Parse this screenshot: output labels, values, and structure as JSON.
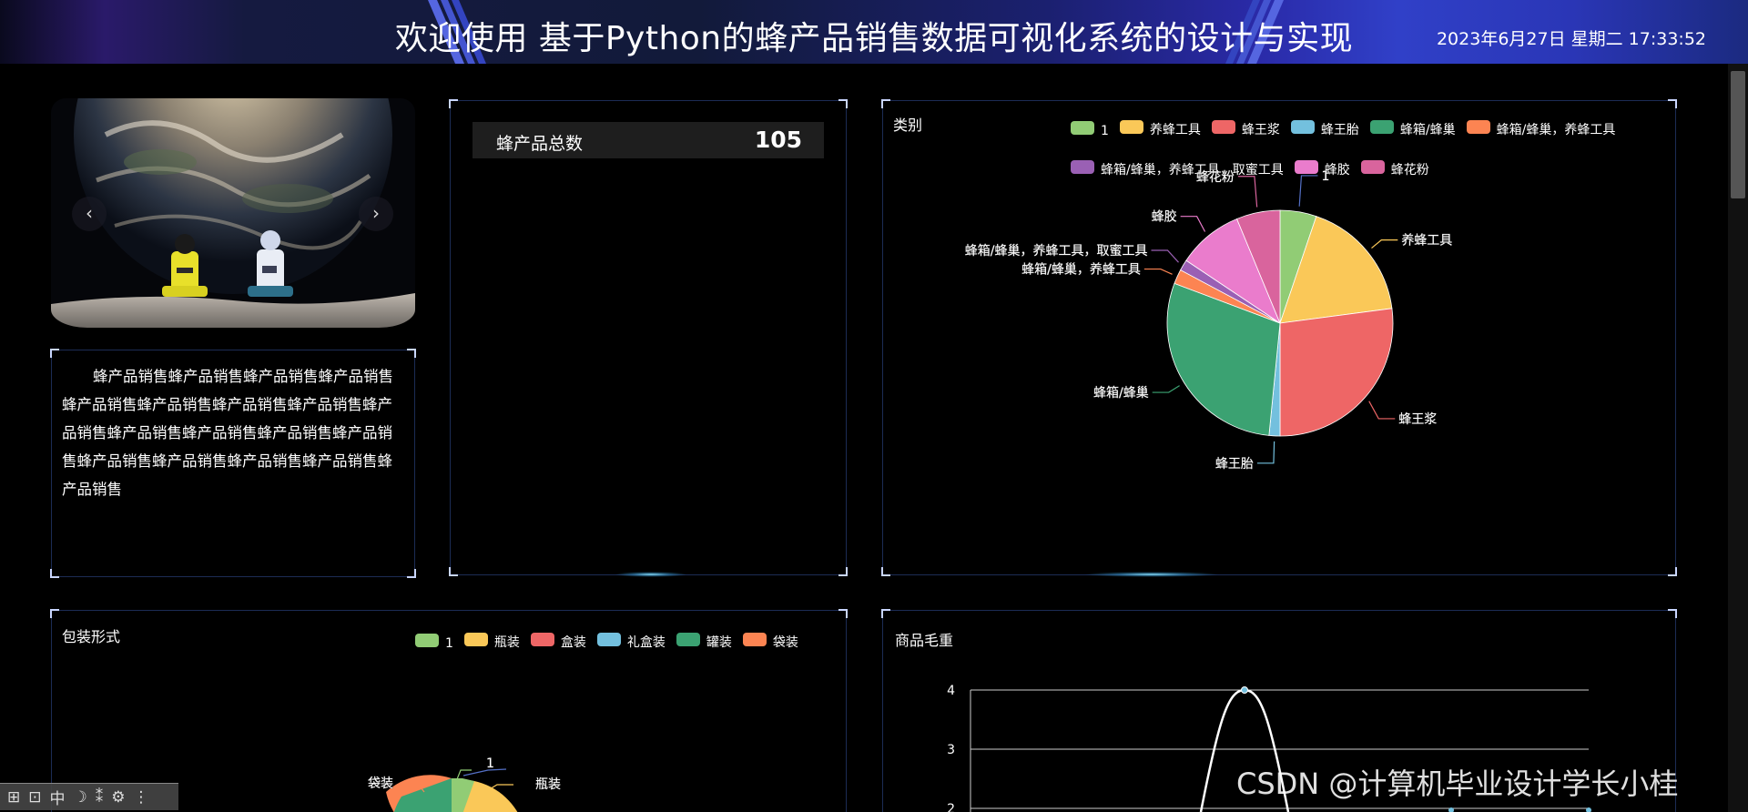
{
  "header": {
    "title": "欢迎使用 基于Python的蜂产品销售数据可视化系统的设计与实现",
    "clock": "2023年6月27日 星期二 17:33:52"
  },
  "carousel": {
    "prev_icon": "chevron-left-icon",
    "next_icon": "chevron-right-icon",
    "prev_glyph": "‹",
    "next_glyph": "›"
  },
  "intro_text": "蜂产品销售蜂产品销售蜂产品销售蜂产品销售蜂产品销售蜂产品销售蜂产品销售蜂产品销售蜂产品销售蜂产品销售蜂产品销售蜂产品销售蜂产品销售蜂产品销售蜂产品销售蜂产品销售蜂产品销售蜂产品销售",
  "stat": {
    "label": "蜂产品总数",
    "value": "105"
  },
  "colors": {
    "c1": "#91cc75",
    "c2": "#fac858",
    "c3": "#ee6666",
    "c4": "#73c0de",
    "c5": "#3ba272",
    "c6": "#fc8452",
    "c7": "#9a60b4",
    "c8": "#ea7ccc",
    "c9": "#d9649d"
  },
  "category_chart": {
    "title": "类别",
    "legend": [
      "1",
      "养蜂工具",
      "蜂王浆",
      "蜂王胎",
      "蜂箱/蜂巢",
      "蜂箱/蜂巢，养蜂工具",
      "蜂箱/蜂巢，养蜂工具，取蜜工具",
      "蜂胶",
      "蜂花粉"
    ],
    "labels": [
      "1",
      "养蜂工具",
      "蜂王浆",
      "蜂王胎",
      "蜂箱/蜂巢",
      "蜂箱/蜂巢，养蜂工具",
      "蜂箱/蜂巢，养蜂工具，取蜜工具",
      "蜂胶",
      "蜂花粉"
    ]
  },
  "package_chart": {
    "title": "包装形式",
    "legend": [
      "1",
      "瓶装",
      "盒装",
      "礼盒装",
      "罐装",
      "袋装"
    ],
    "labels": [
      "袋装",
      "1",
      "瓶装"
    ]
  },
  "weight_chart": {
    "title": "商品毛重",
    "y_ticks": [
      "4",
      "3",
      "2"
    ]
  },
  "chart_data": [
    {
      "type": "pie",
      "title": "类别",
      "categories": [
        "1",
        "养蜂工具",
        "蜂王浆",
        "蜂王胎",
        "蜂箱/蜂巢",
        "蜂箱/蜂巢，养蜂工具",
        "蜂箱/蜂巢，养蜂工具，取蜜工具",
        "蜂胶",
        "蜂花粉"
      ],
      "values": [
        5,
        17,
        26,
        1.5,
        28,
        2,
        1.5,
        9,
        6
      ],
      "legend_position": "top-right"
    },
    {
      "type": "pie",
      "title": "包装形式",
      "categories": [
        "1",
        "瓶装",
        "盒装",
        "礼盒装",
        "罐装",
        "袋装"
      ],
      "legend_position": "top-right"
    },
    {
      "type": "line",
      "title": "商品毛重",
      "y_ticks": [
        2,
        3,
        4
      ],
      "grid": true
    }
  ],
  "watermark": "CSDN @计算机毕业设计学长小桂",
  "toolbar": [
    "⊞",
    "⊡",
    "中",
    "☽",
    "⁑",
    "⚙",
    "⋮"
  ]
}
